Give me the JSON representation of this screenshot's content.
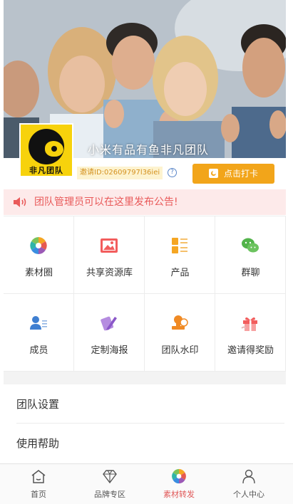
{
  "hero": {
    "team_name": "小米有品有鱼非凡团队",
    "logo_text": "非凡团队"
  },
  "invite": {
    "id_text": "邀请ID:02609797l36iei",
    "help_icon": "question-circle-icon",
    "checkin_label": "点击打卡"
  },
  "notice": {
    "icon": "speaker-icon",
    "text": "团队管理员可以在这里发布公告!"
  },
  "features": [
    {
      "label": "素材圈",
      "icon": "aperture-icon"
    },
    {
      "label": "共享资源库",
      "icon": "image-icon"
    },
    {
      "label": "产品",
      "icon": "product-list-icon"
    },
    {
      "label": "群聊",
      "icon": "wechat-icon"
    },
    {
      "label": "成员",
      "icon": "member-icon"
    },
    {
      "label": "定制海报",
      "icon": "poster-edit-icon"
    },
    {
      "label": "团队水印",
      "icon": "stamp-icon"
    },
    {
      "label": "邀请得奖励",
      "icon": "gift-icon"
    }
  ],
  "menu": [
    {
      "label": "团队设置"
    },
    {
      "label": "使用帮助"
    }
  ],
  "tabbar": [
    {
      "label": "首页",
      "icon": "home-icon",
      "active": false
    },
    {
      "label": "品牌专区",
      "icon": "diamond-icon",
      "active": false
    },
    {
      "label": "素材转发",
      "icon": "aperture-icon",
      "active": true
    },
    {
      "label": "个人中心",
      "icon": "person-icon",
      "active": false
    }
  ],
  "colors": {
    "accent_orange": "#f2a51a",
    "notice_red": "#e95a5a",
    "active_tab": "#e05757",
    "logo_yellow": "#f7d20c"
  }
}
